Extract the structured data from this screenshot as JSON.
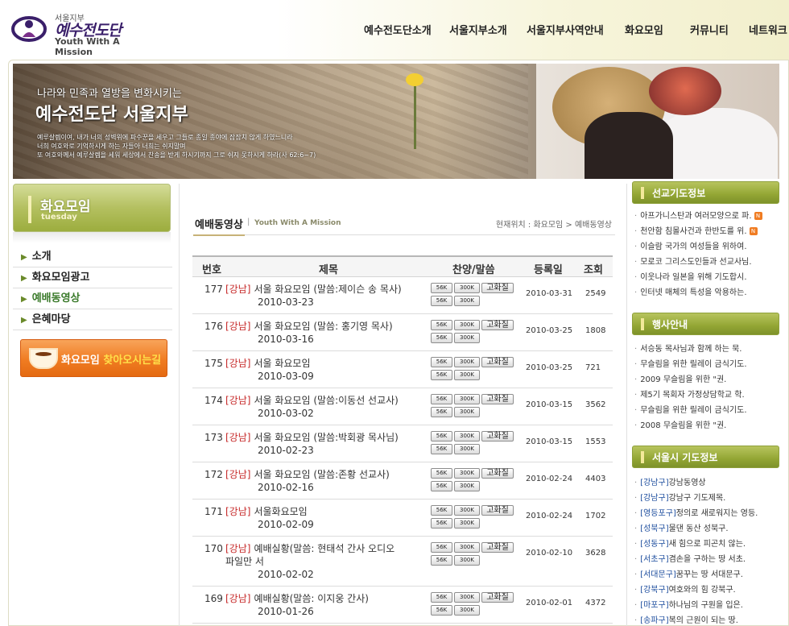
{
  "logo": {
    "org_small": "서울지부",
    "org_big": "예수전도단",
    "org_en": "Youth With A Mission"
  },
  "nav": [
    "예수전도단소개",
    "서울지부소개",
    "서울지부사역안내",
    "화요모임",
    "커뮤니티",
    "네트워크"
  ],
  "banner": {
    "tagline": "나라와 민족과 열방을 변화시키는",
    "headline": "예수전도단 서울지부",
    "verse": [
      "예루살렘이여, 내가 너의 성벽위에 파수꾼을 세우고 그들로 종일 종야에 잠잠치 않게 하였느니라",
      "너희 여호와로 기억하시게  하는 자들아 너희는 쉬지말며",
      "또 여호와께서 예루살렘을 세워 세상에서 찬송을 받게 하시기까지 그로 쉬지 못하시게 하라(사 62:6~7)"
    ]
  },
  "lnb": {
    "title": "화요모임",
    "subtitle": "tuesday",
    "items": [
      "소개",
      "화요모임광고",
      "예배동영상",
      "은혜마당"
    ],
    "active_index": 2,
    "visit_button": {
      "prefix": "화요모임",
      "highlight": "찾아오시는길"
    }
  },
  "page": {
    "title": "예배동영상",
    "separator": "|",
    "subtitle": "Youth With A Mission",
    "breadcrumb": "현재위치 : 화요모임 > 예배동영상"
  },
  "board": {
    "headers": {
      "num": "번호",
      "subject": "제목",
      "media": "찬양/말씀",
      "date": "등록일",
      "views": "조회"
    },
    "button_labels": {
      "low": "56K",
      "high": "300K",
      "hd": "고화질"
    },
    "rows": [
      {
        "num": "177",
        "cat": "[강남]",
        "title": "서울 화요모임 (말씀:제이슨 송 목사)",
        "date": "2010-03-23",
        "reg": "2010-03-31",
        "views": "2549"
      },
      {
        "num": "176",
        "cat": "[강남]",
        "title": "서울 화요모임 (말씀: 홍기영 목사)",
        "date": "2010-03-16",
        "reg": "2010-03-25",
        "views": "1808"
      },
      {
        "num": "175",
        "cat": "[강남]",
        "title": "서울 화요모임",
        "date": "2010-03-09",
        "reg": "2010-03-25",
        "views": "721"
      },
      {
        "num": "174",
        "cat": "[강남]",
        "title": "서울 화요모임 (말씀:이동선 선교사)",
        "date": "2010-03-02",
        "reg": "2010-03-15",
        "views": "3562"
      },
      {
        "num": "173",
        "cat": "[강남]",
        "title": "서울 화요모임 (말씀:박회광 목사님)",
        "date": "2010-02-23",
        "reg": "2010-03-15",
        "views": "1553"
      },
      {
        "num": "172",
        "cat": "[강남]",
        "title": "서울 화요모임 (말씀:존황 선교사)",
        "date": "2010-02-16",
        "reg": "2010-02-24",
        "views": "4403"
      },
      {
        "num": "171",
        "cat": "[강남]",
        "title": "서울화요모임",
        "date": "2010-02-09",
        "reg": "2010-02-24",
        "views": "1702"
      },
      {
        "num": "170",
        "cat": "[강남]",
        "title": "예배실황(말씀: 현태석 간사 오디오 파일만 서",
        "date": "2010-02-02",
        "reg": "2010-02-10",
        "views": "3628"
      },
      {
        "num": "169",
        "cat": "[강남]",
        "title": "예배실황(말씀: 이지웅 간사)",
        "date": "2010-01-26",
        "reg": "2010-02-01",
        "views": "4372"
      }
    ]
  },
  "right": {
    "mission": {
      "title": "선교기도정보",
      "new_badge": "N",
      "items": [
        {
          "text": "아프가니스탄과 여러모양으로 파.",
          "new": true
        },
        {
          "text": "천안함 침몰사건과 한반도를 위.",
          "new": true
        },
        {
          "text": "이슬람 국가의 여성들을 위하여.",
          "new": false
        },
        {
          "text": "모로코 그리스도인들과 선교사님.",
          "new": false
        },
        {
          "text": "이웃나라 일본을 위해 기도합시.",
          "new": false
        },
        {
          "text": "인터넷 매체의 특성을 악용하는.",
          "new": false
        }
      ]
    },
    "events": {
      "title": "행사안내",
      "items": [
        "서승동 목사님과 함께 하는 묵.",
        "무슬림을 위한 릴레이 금식기도.",
        "2009 무슬림을 위한 \"권.",
        "제5기 목회자 가정상담학교 학.",
        "무슬림을 위한 릴레이 금식기도.",
        "2008 무슬림을 위한 \"권."
      ]
    },
    "seoul": {
      "title": "서울시 기도정보",
      "items": [
        {
          "tag": "[강남구]",
          "text": "강남동영상"
        },
        {
          "tag": "[강남구]",
          "text": "강남구 기도제목."
        },
        {
          "tag": "[영등포구]",
          "text": "정의로 새로워지는 영등."
        },
        {
          "tag": "[성북구]",
          "text": "물댄 동산 성북구."
        },
        {
          "tag": "[성동구]",
          "text": "새 힘으로 피곤치 않는."
        },
        {
          "tag": "[서초구]",
          "text": "겸손을 구하는 땅 서초."
        },
        {
          "tag": "[서대문구]",
          "text": "꿈꾸는 땅 서대문구."
        },
        {
          "tag": "[강북구]",
          "text": "여호와의 힘 강북구."
        },
        {
          "tag": "[마포구]",
          "text": "하나님의 구원을 입은."
        },
        {
          "tag": "[송파구]",
          "text": "복의 근원이 되는 땅."
        }
      ]
    }
  },
  "colors": {
    "accent_green": "#93a634",
    "category_red": "#c62828",
    "link_blue": "#1d4d9e",
    "orange": "#f07c22"
  }
}
